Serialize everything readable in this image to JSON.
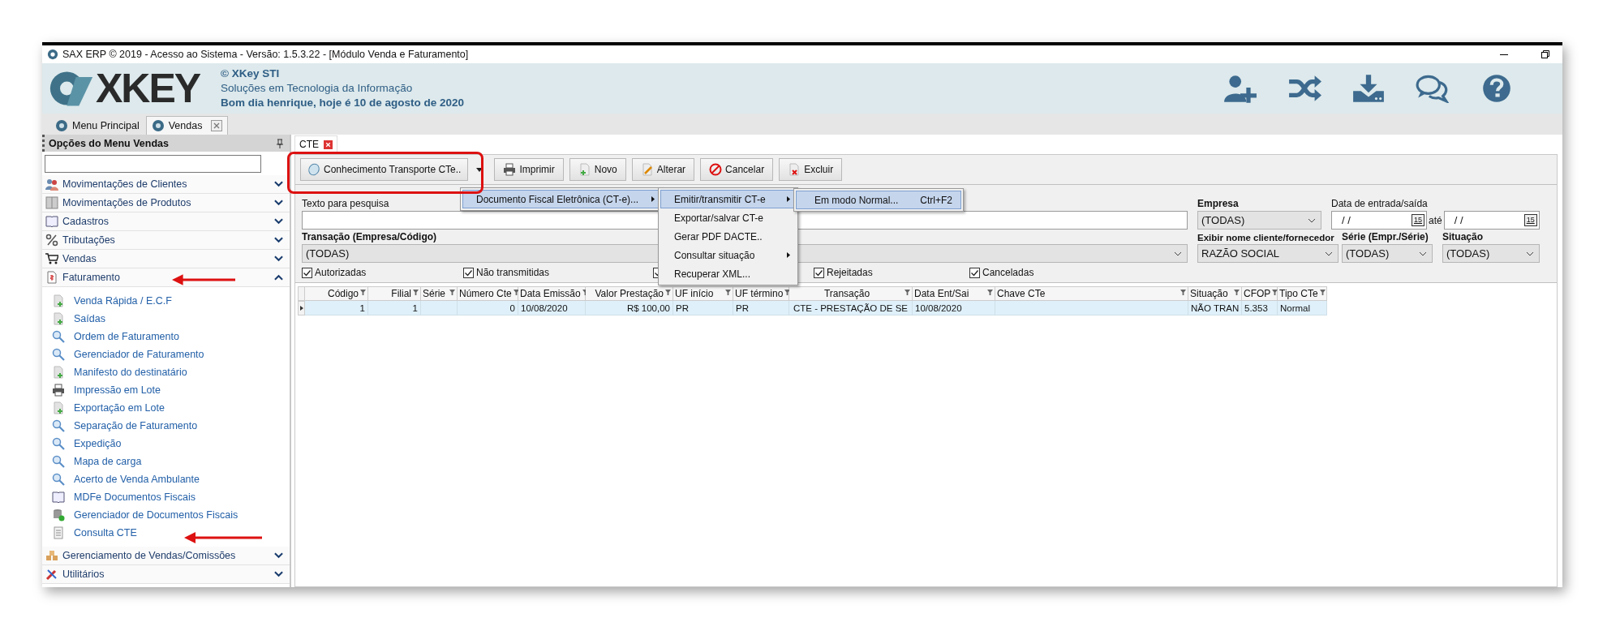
{
  "window": {
    "title": "SAX ERP © 2019 - Acesso ao Sistema - Versão: 1.5.3.22 - [Módulo Venda e Faturamento]"
  },
  "header": {
    "logo": "XKEY",
    "company": "© XKey STI",
    "tagline": "Soluções em Tecnologia da Informação",
    "greeting": "Bom dia henrique, hoje é 10 de agosto de 2020"
  },
  "module_tabs": [
    {
      "label": "Menu Principal",
      "selected": false,
      "closable": false
    },
    {
      "label": "Vendas",
      "selected": true,
      "closable": true
    }
  ],
  "sidebar": {
    "title": "Opções do Menu Vendas",
    "groups": [
      {
        "label": "Movimentações de Clientes",
        "kind": "people",
        "expanded": false
      },
      {
        "label": "Movimentações de Produtos",
        "kind": "cabinet",
        "expanded": false
      },
      {
        "label": "Cadastros",
        "kind": "book",
        "expanded": false
      },
      {
        "label": "Tributações",
        "kind": "percent",
        "expanded": false
      },
      {
        "label": "Vendas",
        "kind": "cart",
        "expanded": false
      },
      {
        "label": "Faturamento",
        "kind": "invoice",
        "expanded": true,
        "children": [
          {
            "label": "Venda Rápida / E.C.F",
            "kind": "doc-add"
          },
          {
            "label": "Saídas",
            "kind": "doc-add"
          },
          {
            "label": "Ordem de Faturamento",
            "kind": "search"
          },
          {
            "label": "Gerenciador de Faturamento",
            "kind": "search"
          },
          {
            "label": "Manifesto do destinatário",
            "kind": "doc-add"
          },
          {
            "label": "Impressão em Lote",
            "kind": "printer"
          },
          {
            "label": "Exportação em Lote",
            "kind": "doc-add"
          },
          {
            "label": "Separação de Faturamento",
            "kind": "search"
          },
          {
            "label": "Expedição",
            "kind": "search"
          },
          {
            "label": "Mapa de carga",
            "kind": "search"
          },
          {
            "label": "Acerto de Venda Ambulante",
            "kind": "search"
          },
          {
            "label": "MDFe Documentos Fiscais",
            "kind": "book"
          },
          {
            "label": "Gerenciador de Documentos Fiscais",
            "kind": "database"
          },
          {
            "label": "Consulta CTE",
            "kind": "sheet"
          }
        ]
      },
      {
        "label": "Gerenciamento de Vendas/Comissões",
        "kind": "boxes",
        "expanded": false
      },
      {
        "label": "Utilitários",
        "kind": "tools",
        "expanded": false
      }
    ]
  },
  "document_tabs": [
    {
      "label": "CTE",
      "selected": true
    }
  ],
  "toolbar": {
    "buttons": [
      {
        "label": "Conhecimento Transporte CTe..",
        "kind": "dropdown"
      },
      {
        "label": "Imprimir",
        "kind": "print"
      },
      {
        "label": "Novo",
        "kind": "new"
      },
      {
        "label": "Alterar",
        "kind": "edit"
      },
      {
        "label": "Cancelar",
        "kind": "cancel"
      },
      {
        "label": "Excluir",
        "kind": "delete"
      }
    ]
  },
  "menus": [
    {
      "items": [
        {
          "label": "Documento Fiscal Eletrônica (CT-e)...",
          "submenu": true,
          "selected": true
        }
      ]
    },
    {
      "items": [
        {
          "label": "Emitir/transmitir CT-e",
          "submenu": true,
          "selected": true
        },
        {
          "label": "Exportar/salvar CT-e",
          "submenu": false,
          "selected": false
        },
        {
          "label": "Gerar PDF DACTE..",
          "submenu": false,
          "selected": false
        },
        {
          "label": "Consultar situação",
          "submenu": true,
          "selected": false
        },
        {
          "label": "Recuperar XML...",
          "submenu": false,
          "selected": false
        }
      ]
    },
    {
      "items": [
        {
          "label": "Em modo Normal...",
          "shortcut": "Ctrl+F2",
          "submenu": false,
          "selected": true
        }
      ]
    }
  ],
  "filters": {
    "search": {
      "label": "Texto para pesquisa"
    },
    "transaction": {
      "label": "Transação (Empresa/Código)",
      "value": "(TODAS)"
    },
    "company": {
      "label": "Empresa",
      "value": "(TODAS)"
    },
    "date_range": {
      "label": "Data de entrada/saída",
      "separator": "até",
      "from": {
        "value": "/ /",
        "calendar": "15"
      },
      "to": {
        "value": "/ /",
        "calendar": "15"
      }
    },
    "name_display": {
      "label": "Exibir nome cliente/fornecedor",
      "value": "RAZÃO SOCIAL"
    },
    "series": {
      "label": "Série (Empr./Série)",
      "value": "(TODAS)"
    },
    "status": {
      "label": "Situação",
      "value": "(TODAS)"
    }
  },
  "status_checks": [
    {
      "label": "Autorizadas",
      "checked": true
    },
    {
      "label": "Não transmitidas",
      "checked": true
    },
    {
      "checked": true
    },
    {
      "label": "Rejeitadas",
      "checked": true
    },
    {
      "label": "Canceladas",
      "checked": true
    }
  ],
  "grid": {
    "columns": [
      "Código",
      "Filial",
      "Série",
      "Número Cte",
      "Data Emissão",
      "Valor Prestação",
      "UF início",
      "UF término",
      "Transação",
      "Data Ent/Sai",
      "Chave CTe",
      "Situação",
      "CFOP",
      "Tipo CTe"
    ],
    "rows": [
      {
        "selected": true,
        "cells": [
          "1",
          "1",
          null,
          "0",
          "10/08/2020",
          "R$ 100,00",
          "PR",
          "PR",
          "CTE - PRESTAÇÃO DE SE",
          "10/08/2020",
          null,
          "NÃO TRAN",
          "5.353",
          "Normal"
        ]
      }
    ]
  }
}
